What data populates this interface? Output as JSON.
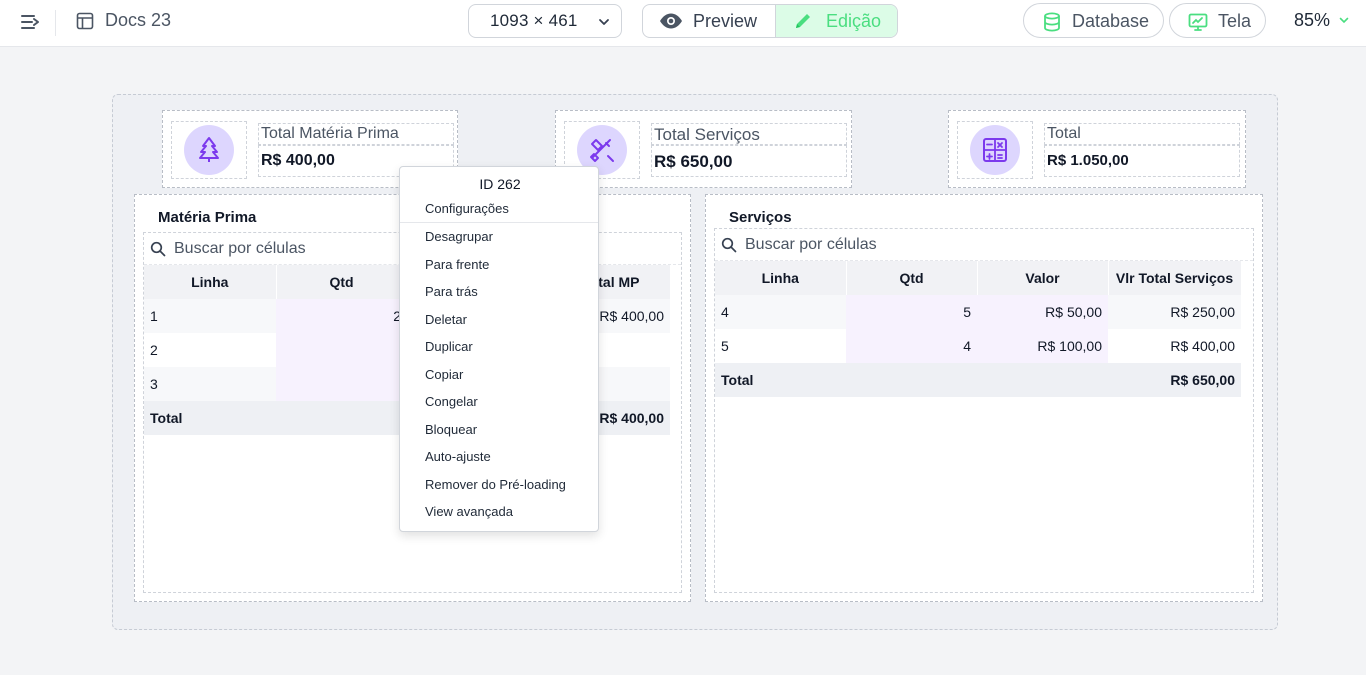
{
  "topbar": {
    "doc_title": "Docs 23",
    "size_selector": "1093 × 461",
    "preview_label": "Preview",
    "edit_label": "Edição",
    "database_label": "Database",
    "tela_label": "Tela",
    "zoom": "85%"
  },
  "colors": {
    "accent_green": "#4ade80",
    "accent_purple": "#7c3aed",
    "icon_circle": "#ddd6fe"
  },
  "cards": [
    {
      "label": "Total Matéria Prima",
      "value": "R$ 400,00",
      "icon": "trees-icon"
    },
    {
      "label": "Total Serviços",
      "value": "R$ 650,00",
      "icon": "tools-icon"
    },
    {
      "label": "Total",
      "value": "R$ 1.050,00",
      "icon": "calculator-icon"
    }
  ],
  "materia": {
    "title": "Matéria Prima",
    "search_placeholder": "Buscar por células",
    "headers": [
      "Linha",
      "Qtd",
      "",
      "otal MP"
    ],
    "rows": [
      [
        "1",
        "2",
        "",
        "R$ 400,00"
      ],
      [
        "2",
        "",
        "",
        ""
      ],
      [
        "3",
        "",
        "",
        ""
      ]
    ],
    "total": {
      "label": "Total",
      "value": "R$ 400,00"
    }
  },
  "servicos": {
    "title": "Serviços",
    "search_placeholder": "Buscar por células",
    "headers": [
      "Linha",
      "Qtd",
      "Valor",
      "Vlr Total Serviços"
    ],
    "rows": [
      [
        "4",
        "5",
        "R$ 50,00",
        "R$ 250,00"
      ],
      [
        "5",
        "4",
        "R$ 100,00",
        "R$ 400,00"
      ]
    ],
    "total": {
      "label": "Total",
      "value": "R$ 650,00"
    }
  },
  "context_menu": {
    "title": "ID 262",
    "items": [
      "Configurações",
      "Desagrupar",
      "Para frente",
      "Para trás",
      "Deletar",
      "Duplicar",
      "Copiar",
      "Congelar",
      "Bloquear",
      "Auto-ajuste",
      "Remover do Pré-loading",
      "View avançada"
    ]
  }
}
